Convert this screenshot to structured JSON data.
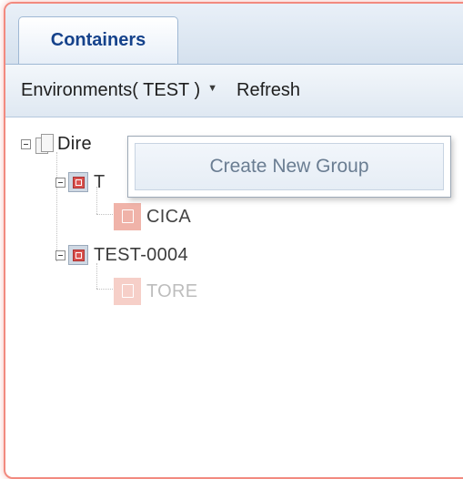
{
  "tabs": [
    {
      "label": "Containers",
      "active": true
    }
  ],
  "toolbar": {
    "environments_label": "Environments( TEST )",
    "dropdown_icon": "caret-down-icon",
    "refresh_label": "Refresh"
  },
  "tree": {
    "root": {
      "label": "Dire",
      "icon": "folder-document-icon",
      "expanded": true
    },
    "groups": [
      {
        "label": "T",
        "icon": "group-box-icon",
        "expanded": true,
        "children": [
          {
            "label": "CICA",
            "icon": "container-icon"
          }
        ]
      },
      {
        "label": "TEST-0004",
        "icon": "group-box-icon",
        "expanded": true,
        "children": [
          {
            "label": "TORE",
            "icon": "container-icon",
            "faded": true
          }
        ]
      }
    ]
  },
  "context_menu": {
    "items": [
      {
        "label": "Create New Group"
      }
    ]
  },
  "colors": {
    "frame_border": "#f28a7f",
    "tab_text": "#15428b",
    "menu_text": "#6a7d92"
  }
}
